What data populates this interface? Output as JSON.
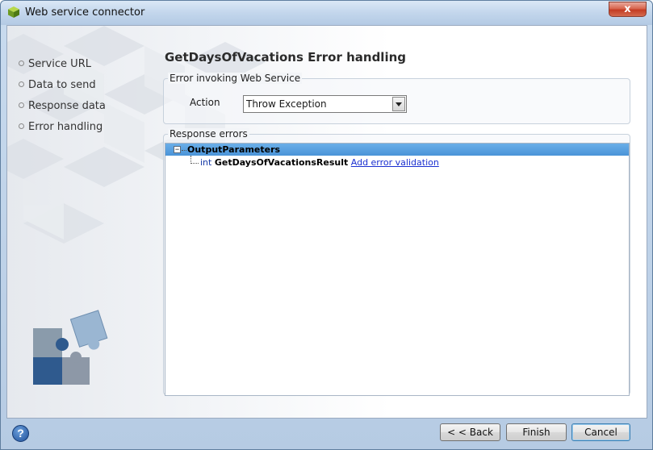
{
  "window": {
    "title": "Web service connector",
    "close_label": "x"
  },
  "nav": {
    "items": [
      {
        "label": "Service URL"
      },
      {
        "label": "Data to send"
      },
      {
        "label": "Response data"
      },
      {
        "label": "Error handling"
      }
    ]
  },
  "main": {
    "heading": "GetDaysOfVacations Error handling",
    "error_group": {
      "title": "Error invoking Web Service",
      "action_label": "Action",
      "action_value": "Throw Exception"
    },
    "response_group": {
      "title": "Response errors",
      "tree": {
        "root": "OutputParameters",
        "expander": "−",
        "child": {
          "type": "int",
          "name": "GetDaysOfVacationsResult",
          "link": "Add error validation"
        }
      }
    }
  },
  "footer": {
    "help": "?",
    "back": "< < Back",
    "finish": "Finish",
    "cancel": "Cancel"
  },
  "colors": {
    "selection": "#4a94d8",
    "link": "#1a2fd0",
    "close": "#c43c23"
  }
}
